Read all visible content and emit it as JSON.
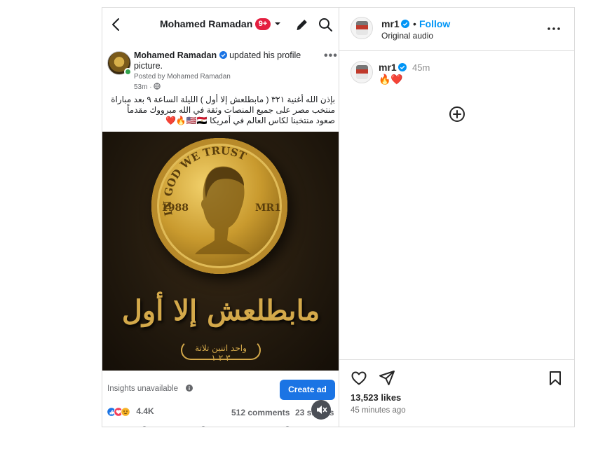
{
  "fb": {
    "header_title": "Mohamed Ramadan",
    "notification_badge": "9+",
    "post": {
      "author": "Mohamed Ramadan",
      "action": "updated his profile picture.",
      "posted_by": "Posted by Mohamed Ramadan",
      "time": "53m",
      "caption": "بإذن الله أغنية ٣٢١ ( مابطلعش إلا أول )  الليلة الساعة ٩ بعد مباراة منتخب مصر على جميع المنصات وثقة في الله مبرووك مقدماً صعود منتخبنا لكاس العالم في أمريكا 🇺🇸🇪🇬🔥❤️",
      "image": {
        "coin_top_text": "IN GOD WE TRUST",
        "coin_year": "1988",
        "coin_mark": "MR1",
        "title": "مابطلعش إلا أول",
        "subtitle": "واحد اتنين تلاتة",
        "subtitle_numbers": "٣  ٢  ١"
      },
      "insights": "Insights unavailable",
      "create_ad": "Create ad",
      "reactions_count": "4.4K",
      "comments": "512 comments",
      "shares": "23 shares"
    }
  },
  "ig": {
    "username": "mr1",
    "separator": "•",
    "follow": "Follow",
    "audio": "Original audio",
    "comment": {
      "username": "mr1",
      "time": "45m",
      "text": "🔥❤️"
    },
    "likes": "13,523 likes",
    "posted_time": "45 minutes ago"
  },
  "colors": {
    "fb_blue": "#1b74e4",
    "ig_blue": "#0095f6",
    "badge_red": "#e41e3f",
    "online_green": "#31a24c",
    "gold": "#d4a94a"
  }
}
